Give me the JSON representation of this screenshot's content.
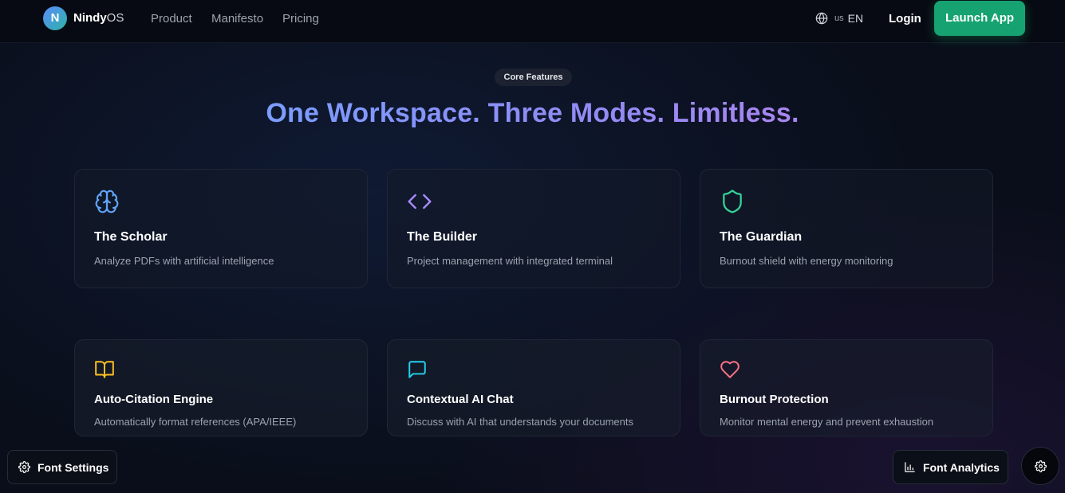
{
  "nav": {
    "logo_letter": "N",
    "brand_name": "Nindy",
    "brand_suffix": "OS",
    "links": [
      "Product",
      "Manifesto",
      "Pricing"
    ],
    "language_flag": "us",
    "language_code": "EN",
    "login_label": "Login",
    "launch_label": "Launch App"
  },
  "hero": {
    "badge": "Core Features",
    "headline": "One Workspace. Three Modes. Limitless."
  },
  "modes": [
    {
      "icon": "brain-icon",
      "title": "The Scholar",
      "description": "Analyze PDFs with artificial intelligence",
      "color": "#60a5fa"
    },
    {
      "icon": "code-icon",
      "title": "The Builder",
      "description": "Project management with integrated terminal",
      "color": "#a78bfa"
    },
    {
      "icon": "shield-icon",
      "title": "The Guardian",
      "description": "Burnout shield with energy monitoring",
      "color": "#34d399"
    }
  ],
  "features": [
    {
      "icon": "book-icon",
      "title": "Auto-Citation Engine",
      "description": "Automatically format references (APA/IEEE)",
      "color": "#fbbf24"
    },
    {
      "icon": "chat-icon",
      "title": "Contextual AI Chat",
      "description": "Discuss with AI that understands your documents",
      "color": "#22d3ee"
    },
    {
      "icon": "heart-icon",
      "title": "Burnout Protection",
      "description": "Monitor mental energy and prevent exhaustion",
      "color": "#fb7185"
    }
  ],
  "floating": {
    "font_settings_label": "Font Settings",
    "font_analytics_label": "Font Analytics"
  },
  "colors": {
    "background": "#0a0e1a",
    "accent_green": "#16a371",
    "headline_gradient_start": "#7b9dff",
    "headline_gradient_end": "#a985f0"
  }
}
